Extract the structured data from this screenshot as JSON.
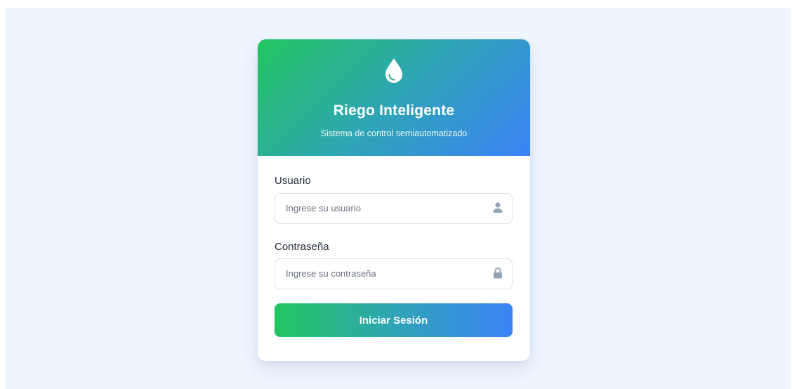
{
  "header": {
    "icon": "water-drop-icon",
    "title": "Riego Inteligente",
    "subtitle": "Sistema de control semiautomatizado"
  },
  "form": {
    "username": {
      "label": "Usuario",
      "placeholder": "Ingrese su usuario",
      "value": "",
      "icon": "user-icon"
    },
    "password": {
      "label": "Contraseña",
      "placeholder": "Ingrese su contraseña",
      "value": "",
      "icon": "lock-icon"
    },
    "submit_label": "Iniciar Sesión"
  },
  "colors": {
    "gradient_start": "#22c55e",
    "gradient_end": "#3b82f6",
    "background": "#eff6ff",
    "icon_gray": "#94a3b8"
  }
}
